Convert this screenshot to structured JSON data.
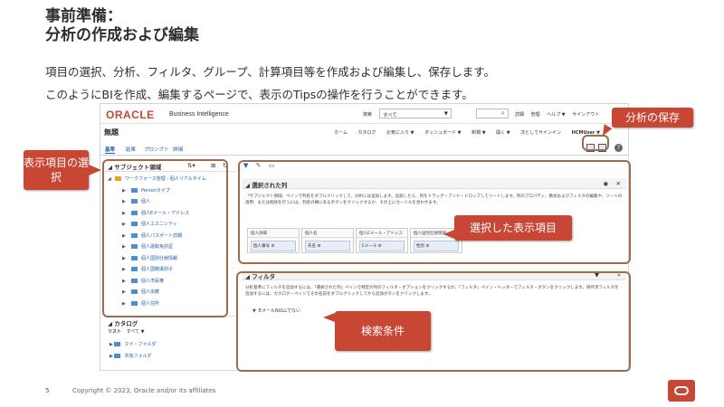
{
  "slide": {
    "title_line1": "事前準備：",
    "title_line2": "分析の作成および編集",
    "desc1": "項目の選択、分析、フィルタ、グループ、計算項目等を作成および編集し、保存します。",
    "desc2": "このようにBIを作成、編集するページで、表示のTipsの操作を行うことができます。"
  },
  "app": {
    "logo": "ORACLE",
    "product": "Business Intelligence",
    "search_label": "検索",
    "search_scope": "すべて",
    "top_links": [
      "詳細",
      "管理",
      "ヘルプ ▼",
      "サインアウト"
    ],
    "doc_title": "無題",
    "nav_links": [
      "ホーム",
      "カタログ",
      "お気に入り ▼",
      "ダッシュボード ▼",
      "新規 ▼",
      "開く ▼",
      "次としてサインイン",
      "HCMUser ▼"
    ],
    "tabs": [
      "基準",
      "結果",
      "プロンプト",
      "詳細"
    ]
  },
  "left": {
    "subject_header": "サブジェクト領域",
    "root_item": "ワークフォース管理 - 個人リアルタイム",
    "items": [
      "Personタイプ",
      "個人",
      "個人Eメール・アドレス",
      "個人エスニシティ",
      "個人パスポート詳細",
      "個人運転免許証",
      "個人国別仕様情報",
      "個人国籍識別子",
      "個人市民権",
      "個人宗教",
      "個人住所"
    ],
    "catalog_header": "カタログ",
    "catalog_list_label": "リスト",
    "catalog_list_value": "すべて",
    "catalog_items": [
      "マイ・フォルダ",
      "共有フォルダ"
    ]
  },
  "selected": {
    "title": "選択された列",
    "text": "「サブジェクト領域」ペインで列名をダブルクリックして、分析には追加します。追加したら、列をドラッグ・アンド・ドロップしてソートします。列のプロパティ、数式およびフィルタの編集や、ソートの適用、または削除を行うには、列名の横にあるボタンをクリックするか、その上にカーソルを合わせます。",
    "columns": [
      {
        "group": "個人詳細",
        "name": "個人番号"
      },
      {
        "group": "個人名",
        "name": "氏名"
      },
      {
        "group": "個人Eメール・アドレス",
        "name": "Eメール"
      },
      {
        "group": "個人国別仕様情報",
        "name": "性別"
      }
    ]
  },
  "filter": {
    "title": "フィルタ",
    "text": "分析基準にフィルタを追加するには、「選択された列」ペインで特定の列のフィルタ・オプションをクリックするか、「フィルタ」ペイン・ヘッダーでフィルタ・ボタンをクリックします。保存済フィルタを追加するには、カタログ・ペインでその名前をダブルクリックしてから追加ボタンをクリックします。",
    "entry": "EメールNULLでない"
  },
  "callouts": {
    "subject": "表示項目の選択",
    "save": "分析の保存",
    "selected": "選択した表示項目",
    "filter": "検索条件"
  },
  "footer": {
    "page": "5",
    "copyright": "Copyright © 2023, Oracle and/or its affiliates"
  },
  "colors": {
    "accent": "#c74634",
    "box": "#9e6b4f",
    "link": "#1f5fa8"
  }
}
